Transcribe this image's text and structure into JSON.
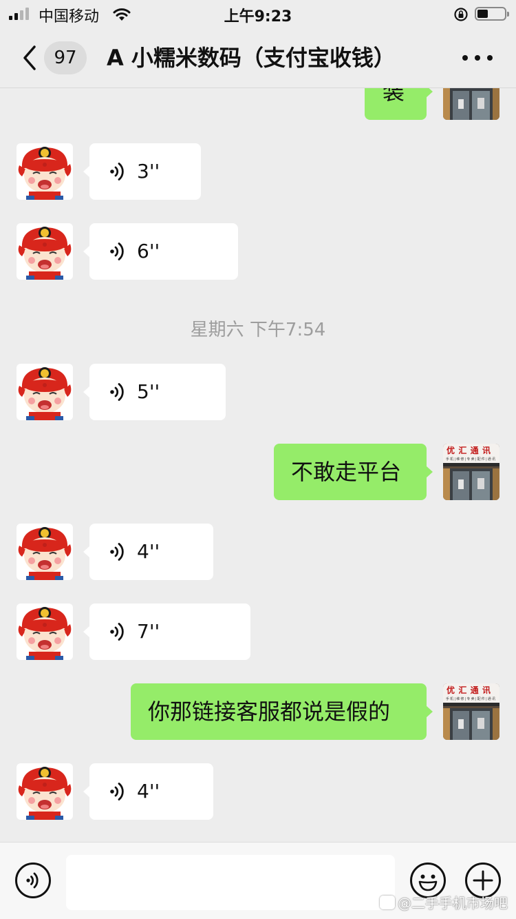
{
  "status_bar": {
    "carrier": "中国移动",
    "time": "上午9:23",
    "battery_level": 0.4
  },
  "nav": {
    "unread_count": "97",
    "title": "A 小糯米数码（支付宝收钱）"
  },
  "messages": [
    {
      "side": "right",
      "type": "text",
      "text": "装"
    },
    {
      "side": "left",
      "type": "voice",
      "duration": "3''"
    },
    {
      "side": "left",
      "type": "voice",
      "duration": "6''"
    },
    {
      "type": "timestamp",
      "text": "星期六 下午7:54"
    },
    {
      "side": "left",
      "type": "voice",
      "duration": "5''"
    },
    {
      "side": "right",
      "type": "text",
      "text": "不敢走平台"
    },
    {
      "side": "left",
      "type": "voice",
      "duration": "4''"
    },
    {
      "side": "left",
      "type": "voice",
      "duration": "7''"
    },
    {
      "side": "right",
      "type": "text",
      "text": "你那链接客服都说是假的"
    },
    {
      "side": "left",
      "type": "voice",
      "duration": "4''"
    }
  ],
  "shop_sign": {
    "name": "优汇通讯",
    "subline": "手机|维修|专卖|配件|通讯"
  },
  "input_bar": {
    "placeholder": "",
    "watermark": "@二手手机市场吧"
  },
  "colors": {
    "background": "#ededed",
    "own_bubble": "#95ec69",
    "other_bubble": "#ffffff"
  },
  "icons": {
    "voice_toggle": "voice-icon",
    "emoji": "smiley-icon",
    "more": "plus-icon"
  }
}
